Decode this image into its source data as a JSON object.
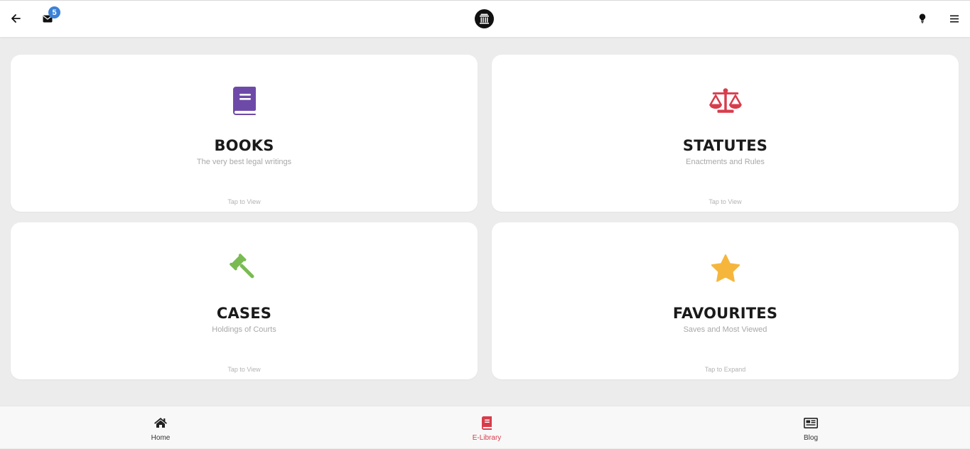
{
  "header": {
    "notification_count": "5"
  },
  "cards": [
    {
      "title": "BOOKS",
      "subtitle": "The very best legal writings",
      "action": "Tap to View",
      "icon": "book-icon",
      "color": "#6e4aa8"
    },
    {
      "title": "STATUTES",
      "subtitle": "Enactments and Rules",
      "action": "Tap to View",
      "icon": "scales-icon",
      "color": "#d83c4b"
    },
    {
      "title": "CASES",
      "subtitle": "Holdings of Courts",
      "action": "Tap to View",
      "icon": "gavel-icon",
      "color": "#79bb52"
    },
    {
      "title": "FAVOURITES",
      "subtitle": "Saves and Most Viewed",
      "action": "Tap to Expand",
      "icon": "star-icon",
      "color": "#f6b63c"
    }
  ],
  "bottom_nav": [
    {
      "label": "Home",
      "icon": "home-icon"
    },
    {
      "label": "E-Library",
      "icon": "book-icon",
      "active": true,
      "color": "#d83c4b"
    },
    {
      "label": "Blog",
      "icon": "newspaper-icon"
    }
  ]
}
